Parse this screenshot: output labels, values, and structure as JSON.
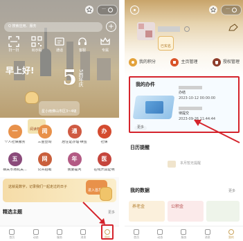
{
  "left": {
    "top_bar": {
      "capsule_dots": "···"
    },
    "search": {
      "placeholder": "Q 搜索应用、服务"
    },
    "hero_icons": [
      {
        "label": "扫一扫"
      },
      {
        "label": "出示码"
      },
      {
        "label": "通话"
      },
      {
        "label": "客服"
      },
      {
        "label": "专属"
      }
    ],
    "greeting": "早上好!",
    "anniversary": "5周年庆",
    "weather": "星小雨佛山市区3~4级",
    "services": [
      {
        "icon": "一",
        "label": "个人社保服务",
        "color": "#e8914a"
      },
      {
        "icon": "阅",
        "label": "三金查询",
        "color": "#e8914a",
        "badge": "阅读权益"
      },
      {
        "icon": "通",
        "label": "居住证办理·续签",
        "color": "#cf5a42"
      },
      {
        "icon": "办",
        "label": "社保",
        "color": "#d44b2f"
      },
      {
        "icon": "五",
        "label": "相关市场机关...",
        "color": "#8a4a7a"
      },
      {
        "icon": "网",
        "label": "公共招聘",
        "color": "#c95f3c"
      },
      {
        "icon": "年",
        "label": "我要提问",
        "color": "#b35a84"
      },
      {
        "icon": "医",
        "label": "在线开具证明",
        "color": "#c5453c"
      }
    ],
    "banner": {
      "text": "这就是数字，记录我们一起走过的日子",
      "cta": "进入首发号"
    },
    "section_title": "精选主题",
    "section_more": "更多",
    "tabs": [
      "首页",
      "动态",
      "服务",
      "消息",
      "我的"
    ]
  },
  "right": {
    "top_bar": {
      "capsule_dots": "···"
    },
    "user_badge": "已实名",
    "quick_actions": [
      {
        "label": "我的积分",
        "color": "#e3a23b"
      },
      {
        "label": "主页管理",
        "color": "#d9542a"
      },
      {
        "label": "授权管理",
        "color": "#8e3d2b"
      }
    ],
    "my_tasks": {
      "title": "我的办件",
      "more": "更多",
      "items": [
        {
          "status": "办结",
          "time": "2023-10-12 00:00:00"
        },
        {
          "status": "待提交",
          "time": "2023-09-26 11:44:44"
        }
      ]
    },
    "calendar": {
      "title": "日历提醒",
      "empty": "本月暂无提醒"
    },
    "my_data": {
      "title": "我的数据",
      "more": "更多",
      "cards": [
        {
          "label": "养老金"
        },
        {
          "label": "公积金"
        }
      ]
    },
    "tabs": [
      "首页",
      "动态",
      "服务",
      "消息",
      "我的"
    ]
  },
  "colors": {
    "accent_red": "#d5232b",
    "warm_orange": "#e8914a",
    "gold": "#c9a35a"
  }
}
